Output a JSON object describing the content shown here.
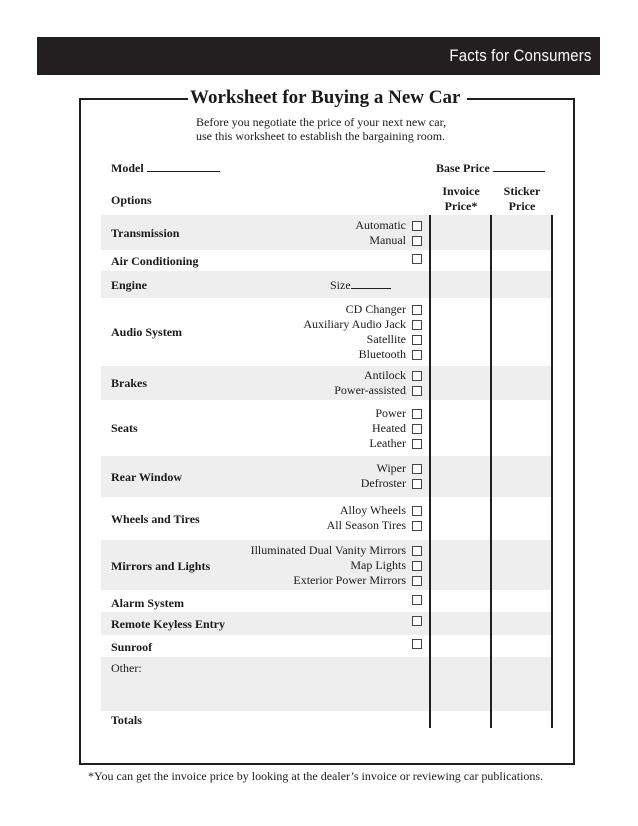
{
  "header": {
    "title": "Facts for Consumers"
  },
  "worksheet": {
    "title": "Worksheet for Buying a New Car",
    "intro_line1": "Before you negotiate the price of your next new car,",
    "intro_line2": "use this worksheet to establish the bargaining room.",
    "model_label": "Model",
    "base_price_label": "Base Price",
    "options_label": "Options",
    "columns": {
      "invoice_line1": "Invoice",
      "invoice_line2": "Price*",
      "sticker_line1": "Sticker",
      "sticker_line2": "Price"
    },
    "rows": [
      {
        "category": "Transmission",
        "options": [
          "Automatic",
          "Manual"
        ]
      },
      {
        "category": "Air Conditioning",
        "options": [
          ""
        ]
      },
      {
        "category": "Engine",
        "size_label": "Size"
      },
      {
        "category": "Audio System",
        "options": [
          "CD Changer",
          "Auxiliary Audio Jack",
          "Satellite",
          "Bluetooth"
        ]
      },
      {
        "category": "Brakes",
        "options": [
          "Antilock",
          "Power-assisted"
        ]
      },
      {
        "category": "Seats",
        "options": [
          "Power",
          "Heated",
          "Leather"
        ]
      },
      {
        "category": "Rear Window",
        "options": [
          "Wiper",
          "Defroster"
        ]
      },
      {
        "category": "Wheels and Tires",
        "options": [
          "Alloy Wheels",
          "All Season Tires"
        ]
      },
      {
        "category": "Mirrors and Lights",
        "options": [
          "Illuminated Dual Vanity Mirrors",
          "Map Lights",
          "Exterior Power Mirrors"
        ]
      },
      {
        "category": "Alarm System",
        "options": [
          ""
        ]
      },
      {
        "category": "Remote Keyless Entry",
        "options": [
          ""
        ]
      },
      {
        "category": "Sunroof",
        "options": [
          ""
        ]
      }
    ],
    "other_label": "Other:",
    "totals_label": "Totals"
  },
  "footnote": "*You can get the invoice price by looking at the dealer’s invoice or reviewing car publications."
}
